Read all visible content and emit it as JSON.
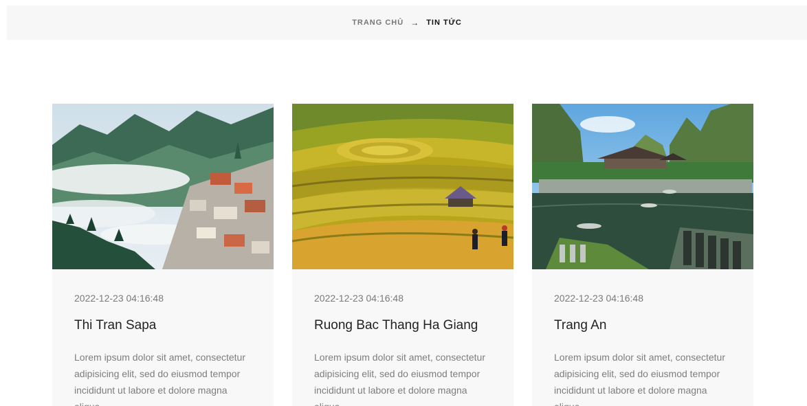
{
  "breadcrumb": {
    "home_label": "TRANG CHỦ",
    "separator_icon": "arrow-right-icon",
    "current_label": "TIN TỨC"
  },
  "posts": [
    {
      "date": "2022-12-23 04:16:48",
      "title": "Thi Tran Sapa",
      "excerpt": "Lorem ipsum dolor sit amet, consectetur adipisicing elit, sed do eiusmod tempor incididunt ut labore et dolore magna aliqua"
    },
    {
      "date": "2022-12-23 04:16:48",
      "title": "Ruong Bac Thang Ha Giang",
      "excerpt": "Lorem ipsum dolor sit amet, consectetur adipisicing elit, sed do eiusmod tempor incididunt ut labore et dolore magna aliqua"
    },
    {
      "date": "2022-12-23 04:16:48",
      "title": "Trang An",
      "excerpt": "Lorem ipsum dolor sit amet, consectetur adipisicing elit, sed do eiusmod tempor incididunt ut labore et dolore magna aliqua"
    }
  ],
  "colors": {
    "breadcrumb_bg": "#f7f7f7",
    "card_bg": "#f8f8f8",
    "title_text": "#222222",
    "muted_text": "#7d7d7d"
  }
}
